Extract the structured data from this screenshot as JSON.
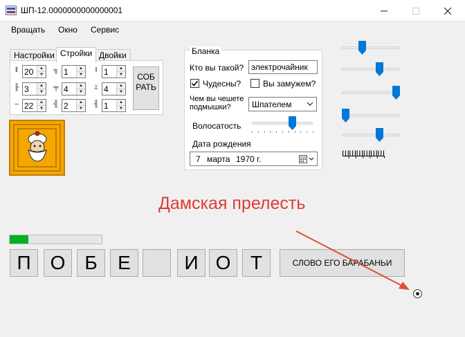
{
  "window": {
    "title": "ШП-12.0000000000000001",
    "icon": "app-icon",
    "controls": {
      "minimize": "minimize-icon",
      "maximize": "maximize-icon",
      "close": "close-icon"
    }
  },
  "menu": [
    "Вращать",
    "Окно",
    "Сервис"
  ],
  "tabs": [
    {
      "label": "Настройки",
      "active": false
    },
    {
      "label": "Стройки",
      "active": true
    },
    {
      "label": "Двойки",
      "active": false
    }
  ],
  "spinners": [
    "20",
    "1",
    "1",
    "3",
    "4",
    "4",
    "22",
    "2",
    "1"
  ],
  "collect_button": {
    "line1": "СОБ",
    "line2": "РАТЬ"
  },
  "form": {
    "legend": "Бланка",
    "who_label": "Кто вы такой?",
    "who_value": "электрочайник",
    "wonders_label": "Чудесны?",
    "wonders_checked": true,
    "married_label": "Вы замужем?",
    "married_checked": false,
    "scratch_label_1": "Чем вы чешете",
    "scratch_label_2": "подмышки?",
    "scratch_value": "Шпателем",
    "hair_label": "Волосатость",
    "hair_level": 0.67,
    "birth_label": "Дата рождения",
    "birth_day": "7",
    "birth_month": "марта",
    "birth_year": "1970 г."
  },
  "right_sliders": [
    0.33,
    0.67,
    1.0,
    0.0,
    0.67
  ],
  "right_label": "ЩЩЩЩЩЩ",
  "headline": "Дамская прелесть",
  "progress": 0.2,
  "letters": [
    "П",
    "О",
    "Б",
    "Е",
    "",
    "И",
    "О",
    "Т"
  ],
  "word_button": "СЛОВО ЕГО БАРАБАНЬИ",
  "colors": {
    "headline": "#e03a2e",
    "arrow": "#e04c3c",
    "progress": "#06b025",
    "avatar": "#f5a700",
    "slider_thumb": "#0078d7"
  }
}
